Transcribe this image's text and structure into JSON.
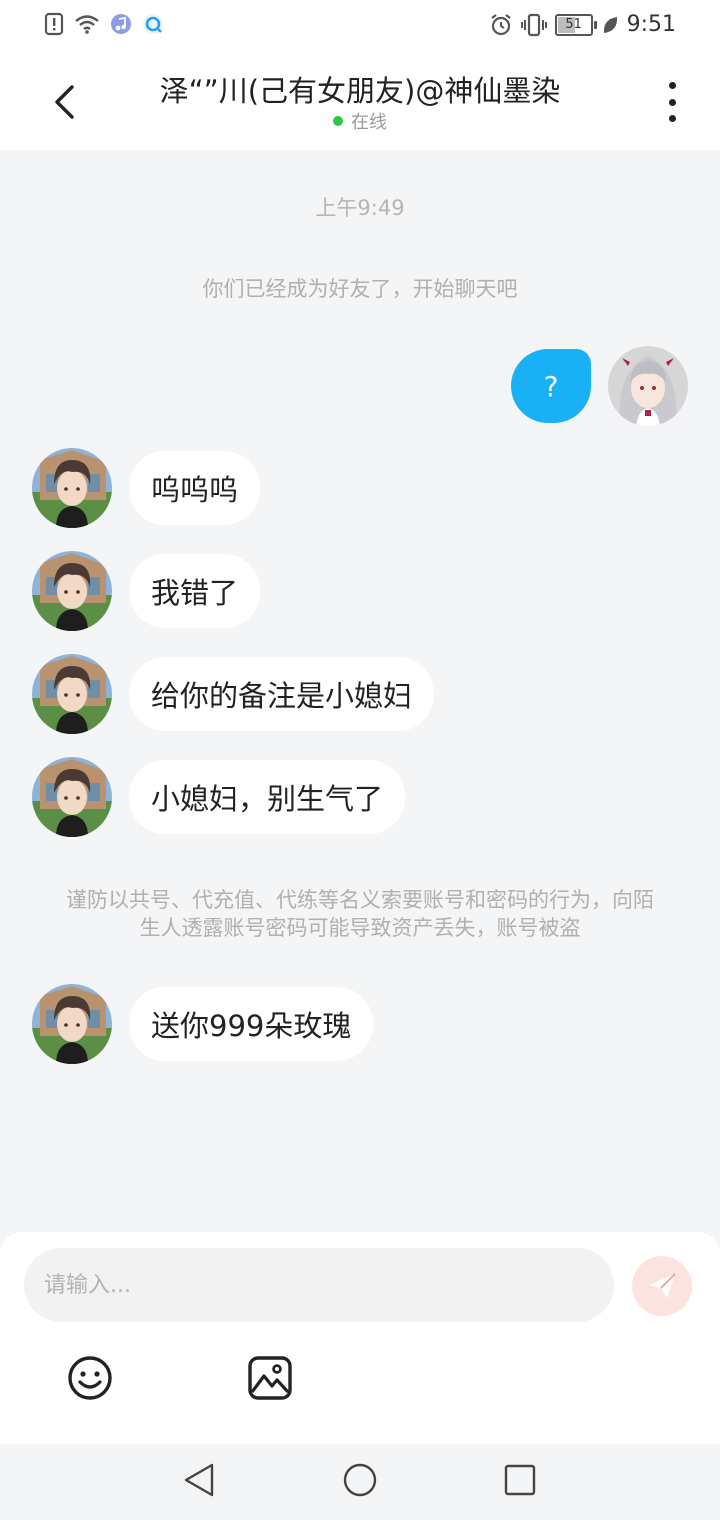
{
  "status_bar": {
    "time": "9:51",
    "battery": "51",
    "battery_level": 0.51,
    "icons": [
      "notification-icon",
      "wifi-icon",
      "music-app-icon",
      "browser-app-icon",
      "alarm-icon",
      "vibrate-icon",
      "battery-icon",
      "leaf-icon"
    ]
  },
  "header": {
    "title": "泽“”川(己有女朋友)@神仙墨染",
    "status": "在线",
    "status_color": "#2bc840"
  },
  "chat": {
    "timestamp": "上午9:49",
    "system_message": "你们已经成为好友了，开始聊天吧",
    "sent_message": "?",
    "received": [
      {
        "text": "呜呜呜"
      },
      {
        "text": "我错了"
      },
      {
        "text": "给你的备注是小媳妇"
      },
      {
        "text": "小媳妇，别生气了"
      }
    ],
    "warning": "谨防以共号、代充值、代练等名义索要账号和密码的行为，向陌生人透露账号密码可能导致资产丢失，账号被盗",
    "last_message": "送你999朵玫瑰"
  },
  "composer": {
    "placeholder": "请输入..."
  },
  "colors": {
    "accent_blue": "#1ab0f6",
    "send_button_bg": "#fde3e0",
    "send_button_icon": "#f7a89c",
    "background": "#f4f5f7"
  }
}
